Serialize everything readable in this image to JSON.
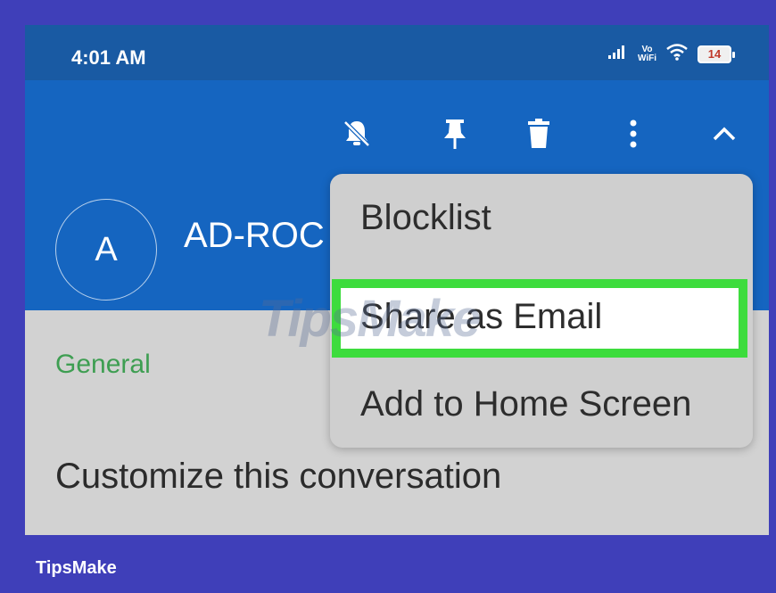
{
  "status_bar": {
    "time": "4:01 AM",
    "volte_top": "Vo",
    "volte_bottom": "WiFi",
    "battery": "14"
  },
  "toolbar": {
    "icons": [
      "bell-off-icon",
      "pin-icon",
      "trash-icon",
      "more-vert-icon",
      "chevron-up-icon"
    ]
  },
  "conversation": {
    "avatar_letter": "A",
    "contact_name": "AD-ROC"
  },
  "content": {
    "section_label": "General",
    "customize_label": "Customize this conversation"
  },
  "menu": {
    "items": [
      {
        "label": "Blocklist"
      },
      {
        "label": "Share as Email"
      },
      {
        "label": "Add to Home Screen"
      }
    ]
  },
  "watermark": "TipsMake",
  "footer": {
    "brand": "TipsMake"
  },
  "colors": {
    "frame": "#3f3fb9",
    "app_bar": "#1565c0",
    "status_bar": "#195aa3",
    "highlight": "#3ddc3d",
    "section_label": "#3e9e52"
  }
}
